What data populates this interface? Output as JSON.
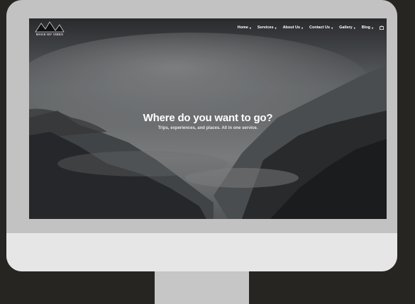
{
  "brand": {
    "name": "MAKE MY VIBES"
  },
  "nav": {
    "items": [
      {
        "label": "Home",
        "icon": "chevron-down-icon"
      },
      {
        "label": "Services",
        "icon": "chevron-down-icon"
      },
      {
        "label": "About Us",
        "icon": "chevron-down-icon"
      },
      {
        "label": "Contact Us",
        "icon": "chevron-down-icon"
      },
      {
        "label": "Gallery",
        "icon": "chevron-down-icon"
      },
      {
        "label": "Blog",
        "icon": "chevron-down-icon"
      }
    ],
    "trailing_icon": "cart-icon"
  },
  "hero": {
    "title": "Where do you want to go?",
    "subtitle": "Trips, experiences, and places. All in one service."
  },
  "colors": {
    "page_background": "#262522",
    "monitor_bezel": "#c2c2c2",
    "monitor_chin": "#e6e6e6",
    "hero_text": "#ffffff"
  }
}
